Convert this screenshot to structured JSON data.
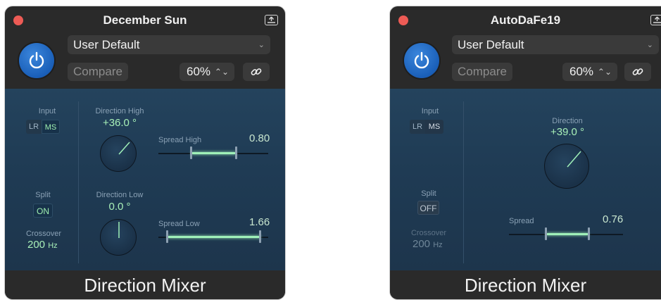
{
  "window1": {
    "title": "December Sun",
    "preset": "User Default",
    "compare": "Compare",
    "mix": "60%",
    "input_label": "Input",
    "input_left": "LR",
    "input_right": "MS",
    "split_label": "Split",
    "split_state": "ON",
    "crossover_label": "Crossover",
    "crossover_value": "200",
    "crossover_unit": "Hz",
    "dir_high_label": "Direction High",
    "dir_high_value": "+36.0 °",
    "dir_low_label": "Direction Low",
    "dir_low_value": "0.0 °",
    "spread_high_label": "Spread High",
    "spread_high_value": "0.80",
    "spread_low_label": "Spread Low",
    "spread_low_value": "1.66",
    "footer": "Direction Mixer"
  },
  "window2": {
    "title": "AutoDaFe19",
    "preset": "User Default",
    "compare": "Compare",
    "mix": "60%",
    "input_label": "Input",
    "input_left": "LR",
    "input_right": "MS",
    "split_label": "Split",
    "split_state": "OFF",
    "crossover_label": "Crossover",
    "crossover_value": "200",
    "crossover_unit": "Hz",
    "direction_label": "Direction",
    "direction_value": "+39.0 °",
    "spread_label": "Spread",
    "spread_value": "0.76",
    "footer": "Direction Mixer"
  },
  "icons": {
    "close": "close-dot-icon",
    "expand": "expand-window-icon",
    "power": "power-icon",
    "link": "link-icon",
    "dropdown": "chevron-down-icon",
    "stepper": "stepper-icon"
  },
  "colors": {
    "accent_blue": "#1a5fb8",
    "value_green": "#a8f0b8",
    "close_red": "#ed5b55",
    "panel_blue": "#1f3b54"
  }
}
